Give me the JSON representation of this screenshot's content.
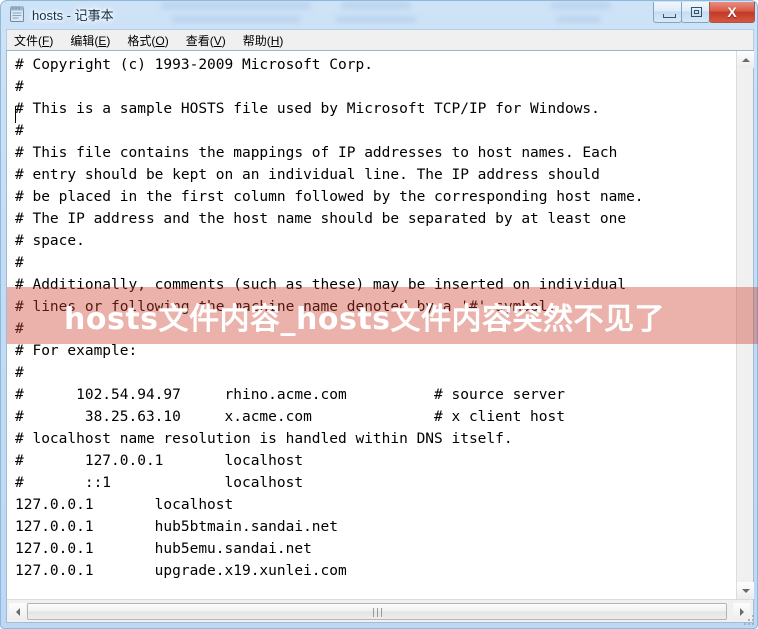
{
  "window": {
    "title": "hosts - 记事本",
    "icon": "notepad-icon"
  },
  "titlebar_buttons": {
    "minimize": "—",
    "maximize": "□",
    "close": "X"
  },
  "menu": [
    {
      "label": "文件(F)",
      "text": "文件(",
      "accel": "F",
      "tail": ")"
    },
    {
      "label": "编辑(E)",
      "text": "编辑(",
      "accel": "E",
      "tail": ")"
    },
    {
      "label": "格式(O)",
      "text": "格式(",
      "accel": "O",
      "tail": ")"
    },
    {
      "label": "查看(V)",
      "text": "查看(",
      "accel": "V",
      "tail": ")"
    },
    {
      "label": "帮助(H)",
      "text": "帮助(",
      "accel": "H",
      "tail": ")"
    }
  ],
  "editor": {
    "content": "# Copyright (c) 1993-2009 Microsoft Corp.\n#\n# This is a sample HOSTS file used by Microsoft TCP/IP for Windows.\n#\n# This file contains the mappings of IP addresses to host names. Each\n# entry should be kept on an individual line. The IP address should\n# be placed in the first column followed by the corresponding host name.\n# The IP address and the host name should be separated by at least one\n# space.\n#\n# Additionally, comments (such as these) may be inserted on individual\n# lines or following the machine name denoted by a '#' symbol.\n#\n# For example:\n#\n#      102.54.94.97     rhino.acme.com          # source server\n#       38.25.63.10     x.acme.com              # x client host\n# localhost name resolution is handled within DNS itself.\n#       127.0.0.1       localhost\n#       ::1             localhost\n127.0.0.1       localhost\n127.0.0.1       hub5btmain.sandai.net\n127.0.0.1       hub5emu.sandai.net\n127.0.0.1       upgrade.x19.xunlei.com"
  },
  "overlay": {
    "text": "hosts文件内容_hosts文件内容突然不见了",
    "background_color": "#d9847d",
    "text_color": "#ffffff"
  },
  "scrollbars": {
    "vertical_up": "▲",
    "vertical_down": "▼",
    "horizontal_left": "◄",
    "horizontal_right": "►"
  }
}
